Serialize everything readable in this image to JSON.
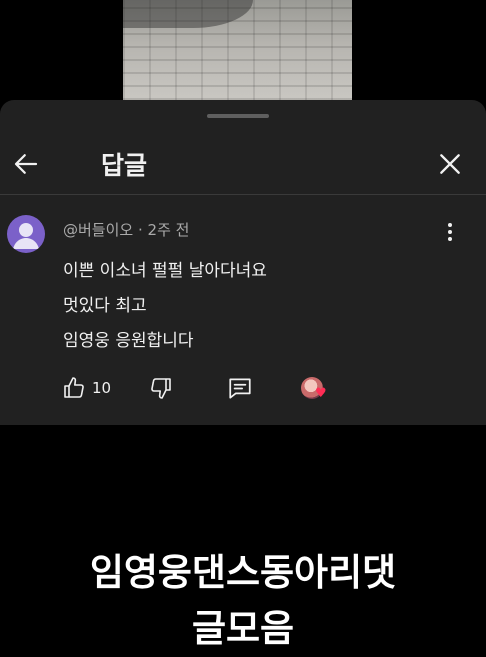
{
  "header": {
    "title": "답글"
  },
  "comment": {
    "author": "@버들이오",
    "time": "2주 전",
    "separator": "·",
    "lines": [
      "이쁜 이소녀 펄펄 날아다녀요",
      "멋있다 최고",
      "임영웅 응원합니다"
    ],
    "like_count": "10"
  },
  "caption": {
    "line1": "임영웅댄스동아리댓",
    "line2": "글모음"
  },
  "icons": {
    "back": "arrow-left-icon",
    "close": "close-icon",
    "menu": "more-vertical-icon",
    "like": "thumbs-up-icon",
    "dislike": "thumbs-down-icon",
    "reply": "comment-icon",
    "creator_heart": "heart-icon"
  },
  "colors": {
    "sheet": "#212121",
    "avatar": "#7b61c9",
    "heart": "#ff2d55"
  }
}
